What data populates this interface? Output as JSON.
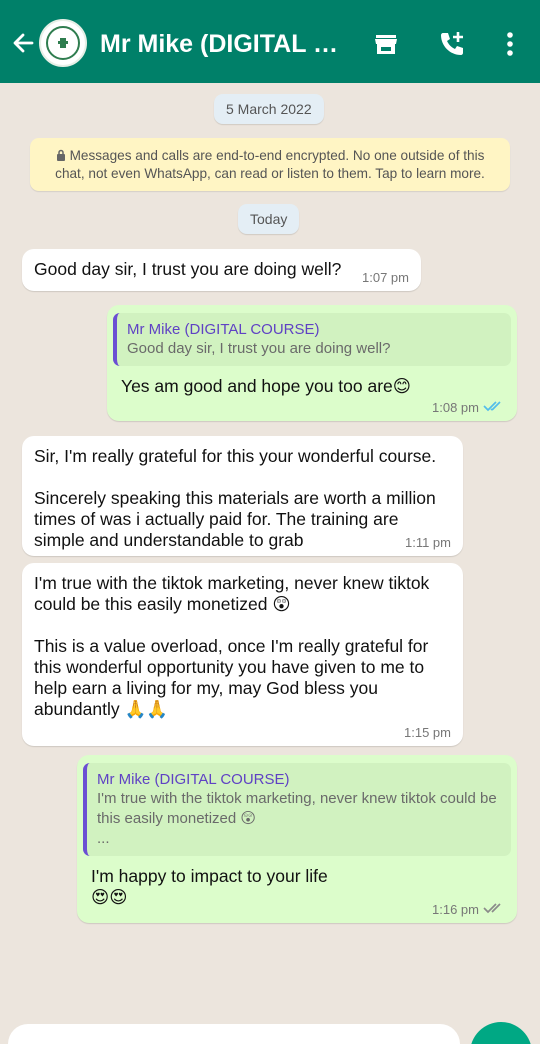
{
  "header": {
    "back_icon": "arrow-left-icon",
    "avatar_icon": "profile-logo-icon",
    "title": "Mr Mike (DIGITAL C...",
    "shop_icon": "store-icon",
    "call_icon": "add-call-icon",
    "menu_icon": "more-vertical-icon",
    "color": "#008069"
  },
  "chat": {
    "date_label": "5 March 2022",
    "encryption_notice": "Messages and calls are end-to-end encrypted. No one outside of this chat, not even WhatsApp, can read or listen to them. Tap to learn more.",
    "today_label": "Today",
    "messages": [
      {
        "direction": "incoming",
        "text": "Good day sir, I trust you are doing well?",
        "time": "1:07 pm"
      },
      {
        "direction": "outgoing",
        "quote_author": "Mr Mike (DIGITAL COURSE)",
        "quote_text": "Good day sir, I trust you are doing well?",
        "text": "Yes am good and hope you too are😊",
        "time": "1:08 pm",
        "status": "read"
      },
      {
        "direction": "incoming",
        "text": "Sir, I'm really grateful for this your wonderful course.\n\nSincerely speaking this materials are worth a million times of was i actually paid for. The training are simple and understandable to grab",
        "time": "1:11 pm"
      },
      {
        "direction": "incoming",
        "text": "I'm true with the tiktok marketing, never knew tiktok could be this easily monetized 😲\n\nThis is a value overload, once I'm really grateful for this wonderful opportunity you have given to me to help earn a living for my, may God bless you abundantly 🙏🙏",
        "time": "1:15 pm"
      },
      {
        "direction": "outgoing",
        "quote_author": "Mr Mike (DIGITAL COURSE)",
        "quote_text": "I'm true with the tiktok marketing, never knew tiktok could be this easily monetized 😲\n...",
        "text": "I'm happy to impact to your life\n😍😍",
        "time": "1:16 pm",
        "status": "delivered"
      }
    ]
  },
  "colors": {
    "incoming_bubble": "#ffffff",
    "outgoing_bubble": "#dcfdcb",
    "read_tick": "#53bdeb",
    "delivered_tick": "#8a8a8a",
    "send_button": "#00a884"
  }
}
